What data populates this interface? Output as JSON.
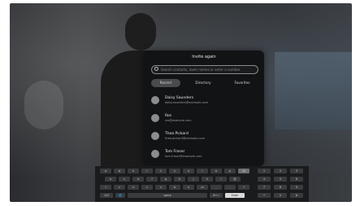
{
  "modal": {
    "title": "Invite again",
    "search_placeholder": "Search contacts, room names or enter a number",
    "tabs": [
      {
        "label": "Recent",
        "active": true
      },
      {
        "label": "Directory",
        "active": false
      },
      {
        "label": "Favorites",
        "active": false
      }
    ],
    "contacts": [
      {
        "name": "Daisy Saunders",
        "detail": "daisy.saunders@example.com"
      },
      {
        "name": "Ros",
        "detail": "ros@example.com"
      },
      {
        "name": "Thea Pickard",
        "detail": "thea.pickard@example.com"
      },
      {
        "name": "Tom Fraser",
        "detail": "tom.fraser@example.com"
      }
    ]
  },
  "keyboard": {
    "row1": [
      "q",
      "w",
      "e",
      "r",
      "t",
      "y",
      "u",
      "i",
      "o",
      "p",
      "⌫"
    ],
    "row2": [
      "a",
      "s",
      "d",
      "f",
      "g",
      "h",
      "j",
      "k",
      "l",
      "@"
    ],
    "row3": [
      "⇧",
      "z",
      "x",
      "c",
      "v",
      "b",
      "n",
      "m",
      ",",
      ".",
      "⇧"
    ],
    "row4": [
      "123",
      "🌐",
      "space",
      "#+=",
      "Enter"
    ],
    "numpad": [
      "1",
      "2",
      "3",
      "4",
      "5",
      "6",
      "7",
      "8",
      "9",
      "*",
      "0",
      "#"
    ]
  },
  "colors": {
    "modal_bg": "#121315",
    "tab_active": "#4a4b4e",
    "enter_key": "#d9d9d9"
  }
}
